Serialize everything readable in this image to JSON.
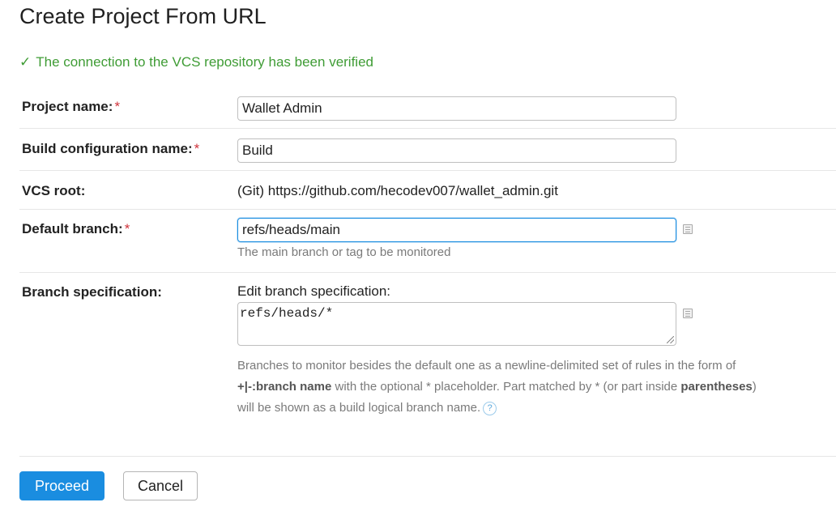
{
  "title": "Create Project From URL",
  "status": {
    "icon": "checkmark-icon",
    "check_glyph": "✓",
    "text": "The connection to the VCS repository has been verified",
    "color": "#3f9c35"
  },
  "required_mark": "*",
  "form": {
    "project_name": {
      "label": "Project name:",
      "value": "Wallet Admin"
    },
    "build_config_name": {
      "label": "Build configuration name:",
      "value": "Build"
    },
    "vcs_root": {
      "label": "VCS root:",
      "value": "(Git) https://github.com/hecodev007/wallet_admin.git"
    },
    "default_branch": {
      "label": "Default branch:",
      "value": "refs/heads/main",
      "note": "The main branch or tag to be monitored",
      "icon": "document-icon"
    },
    "branch_spec": {
      "label": "Branch specification:",
      "edit_label": "Edit branch specification:",
      "value": "refs/heads/*",
      "icon": "document-icon",
      "help": {
        "line1": "Branches to monitor besides the default one as a newline-delimited set of rules in the form of",
        "syntax": "+|-:branch name",
        "middle": " with the optional * placeholder. Part matched by * (or part inside ",
        "parentheses": "parentheses",
        "close": ")",
        "line3": "will be shown as a build logical branch name.",
        "help_icon": "question-mark-icon",
        "help_glyph": "?"
      }
    }
  },
  "buttons": {
    "proceed": "Proceed",
    "cancel": "Cancel"
  },
  "colors": {
    "accent": "#1a8de0",
    "required": "#d0343c"
  }
}
